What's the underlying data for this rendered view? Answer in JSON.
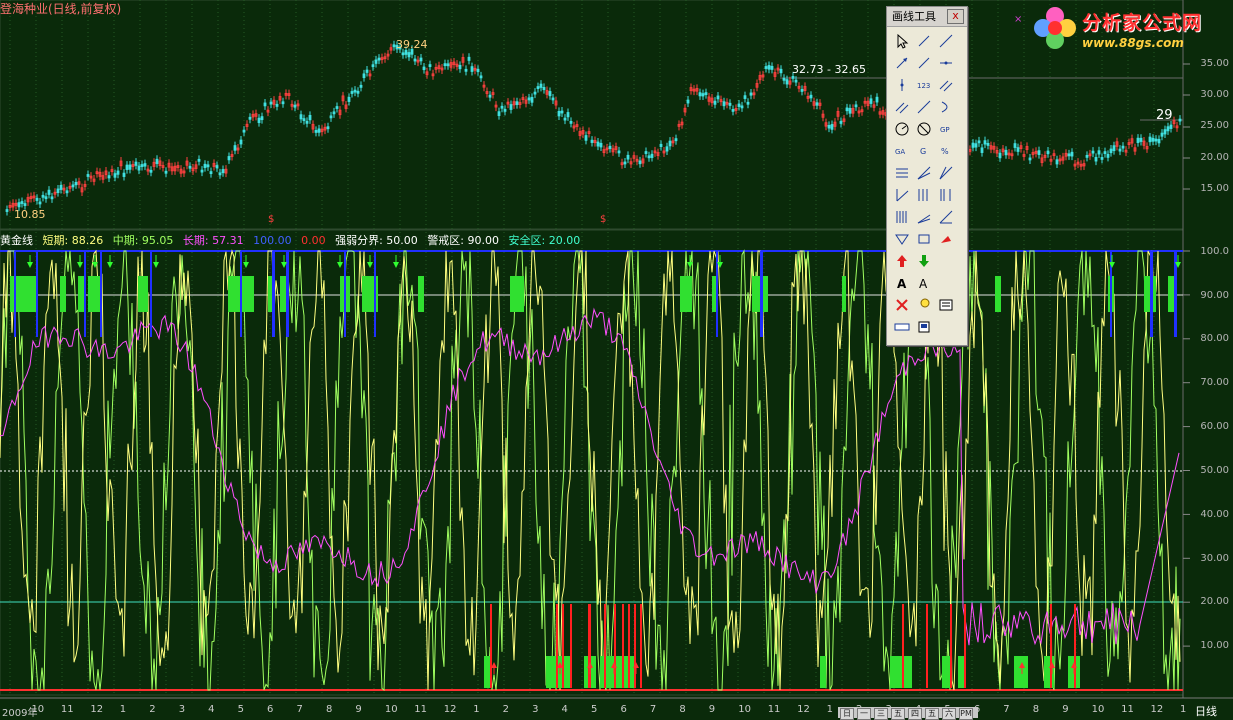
{
  "title": "登海种业(日线,前复权)",
  "logo": {
    "text": "分析家公式网",
    "url": "www.88gs.com"
  },
  "price_labels": {
    "high": "39.24",
    "low": "10.85",
    "range": "32.73 - 32.65",
    "last": "29"
  },
  "signal_marks": [
    "$",
    "$"
  ],
  "price_axis": [
    "35.00",
    "30.00",
    "25.00",
    "20.00",
    "15.00"
  ],
  "indicator": {
    "name": "黄金线",
    "short_label": "短期: 88.26",
    "mid_label": "中期: 95.05",
    "long_label": "长期: 57.31",
    "v100": "100.00",
    "v0": "0.00",
    "divide": "强弱分界: 50.00",
    "warn": "警戒区: 90.00",
    "safe": "安全区: 20.00",
    "colors": {
      "short": "#ffff80",
      "mid": "#a0ff60",
      "long": "#ff50ff"
    }
  },
  "indicator_axis": [
    "100.0",
    "90.00",
    "80.00",
    "70.00",
    "60.00",
    "50.00",
    "40.00",
    "30.00",
    "20.00",
    "10.00"
  ],
  "x_labels": [
    "2009年",
    "10",
    "11",
    "12",
    "1",
    "2",
    "3",
    "4",
    "5",
    "6",
    "7",
    "8",
    "9",
    "10",
    "11",
    "12",
    "1",
    "2",
    "3",
    "4",
    "5",
    "6",
    "7",
    "8",
    "9",
    "10",
    "11",
    "12",
    "1",
    "2",
    "3",
    "4",
    "5",
    "6",
    "7",
    "8",
    "9",
    "10",
    "11",
    "12",
    "1"
  ],
  "period": "日线",
  "toolbox": {
    "title": "画线工具",
    "close": "x",
    "tools": [
      "cursor-icon",
      "line-icon",
      "ray-icon",
      "arrow-line-icon",
      "segment-icon",
      "hline-icon",
      "vline-icon",
      "fib-label-icon",
      "parallel-icon",
      "channel-icon",
      "trend-icon",
      "arc-icon",
      "circle-icon",
      "cross-circle-icon",
      "gp-icon",
      "ga-icon",
      "g-icon",
      "percent-icon",
      "text-lines-icon",
      "fan-icon",
      "fan2-icon",
      "gann-line-icon",
      "period-lines-icon",
      "speed-lines-icon",
      "bars-icon",
      "angle-icon",
      "angle2-icon",
      "triangle-icon",
      "rect-icon",
      "red-flag-icon",
      "up-arrow-icon",
      "down-arrow-icon",
      "blank-icon",
      "text-a-icon",
      "text-a2-icon",
      "blank2-icon",
      "delete-icon",
      "bulb-icon",
      "list-icon",
      "ruler-icon",
      "save-icon"
    ]
  },
  "bottom_buttons": [
    "日",
    "一",
    "三",
    "五",
    "四",
    "五",
    "六",
    "PM"
  ]
}
